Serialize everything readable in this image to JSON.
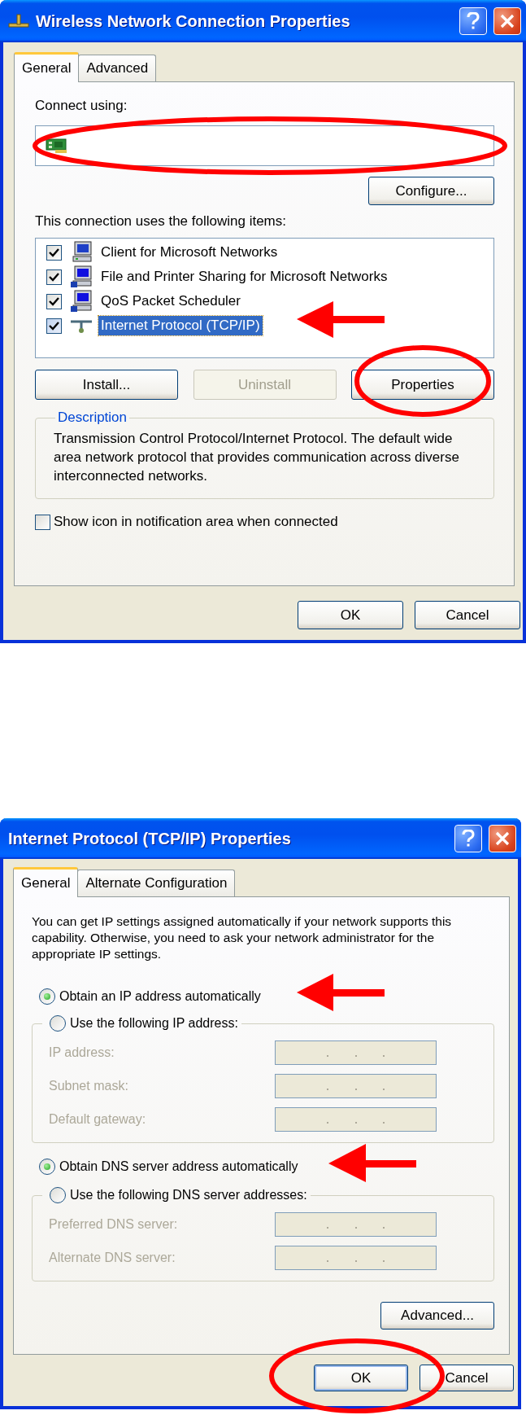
{
  "connection_dialog": {
    "title": "Wireless Network Connection Properties",
    "tabs": [
      {
        "label": "General",
        "selected": true
      },
      {
        "label": "Advanced",
        "selected": false
      }
    ],
    "connect_label": "Connect using:",
    "configure_button": "Configure...",
    "items_label": "This connection uses the following items:",
    "items": [
      {
        "kind": "client",
        "label": "Client for Microsoft Networks",
        "checked": true,
        "selected": false
      },
      {
        "kind": "service",
        "label": "File and Printer Sharing for Microsoft Networks",
        "checked": true,
        "selected": false
      },
      {
        "kind": "service",
        "label": "QoS Packet Scheduler",
        "checked": true,
        "selected": false
      },
      {
        "kind": "protocol",
        "label": "Internet Protocol (TCP/IP)",
        "checked": true,
        "selected": true
      }
    ],
    "item_buttons": [
      {
        "label": "Install...",
        "disabled": false
      },
      {
        "label": "Uninstall",
        "disabled": true
      },
      {
        "label": "Properties",
        "disabled": false
      }
    ],
    "description": {
      "legend": "Description",
      "text": "Transmission Control Protocol/Internet Protocol. The default wide area network protocol that provides communication across diverse interconnected networks."
    },
    "show_icon": {
      "label": "Show icon in notification area when connected",
      "checked": false
    },
    "footer_buttons": [
      {
        "label": "OK",
        "focused": false
      },
      {
        "label": "Cancel",
        "focused": false
      }
    ]
  },
  "tcpip_dialog": {
    "title": "Internet Protocol (TCP/IP) Properties",
    "tabs": [
      {
        "label": "General",
        "selected": true
      },
      {
        "label": "Alternate Configuration",
        "selected": false
      }
    ],
    "intro": "You can get IP settings assigned automatically if your network supports this capability. Otherwise, you need to ask your network administrator for the appropriate IP settings.",
    "sections": [
      {
        "auto_option": {
          "label": "Obtain an IP address automatically",
          "selected": true
        },
        "manual_option": {
          "label": "Use the following IP address:",
          "selected": false
        },
        "fields": [
          {
            "label": "IP address:",
            "disabled": true
          },
          {
            "label": "Subnet mask:",
            "disabled": true
          },
          {
            "label": "Default gateway:",
            "disabled": true
          }
        ]
      },
      {
        "auto_option": {
          "label": "Obtain DNS server address automatically",
          "selected": true
        },
        "manual_option": {
          "label": "Use the following DNS server addresses:",
          "selected": false
        },
        "fields": [
          {
            "label": "Preferred DNS server:",
            "disabled": true
          },
          {
            "label": "Alternate DNS server:",
            "disabled": true
          }
        ]
      }
    ],
    "advanced_button": "Advanced...",
    "footer_buttons": [
      {
        "label": "OK",
        "focused": true
      },
      {
        "label": "Cancel",
        "focused": false
      }
    ]
  }
}
